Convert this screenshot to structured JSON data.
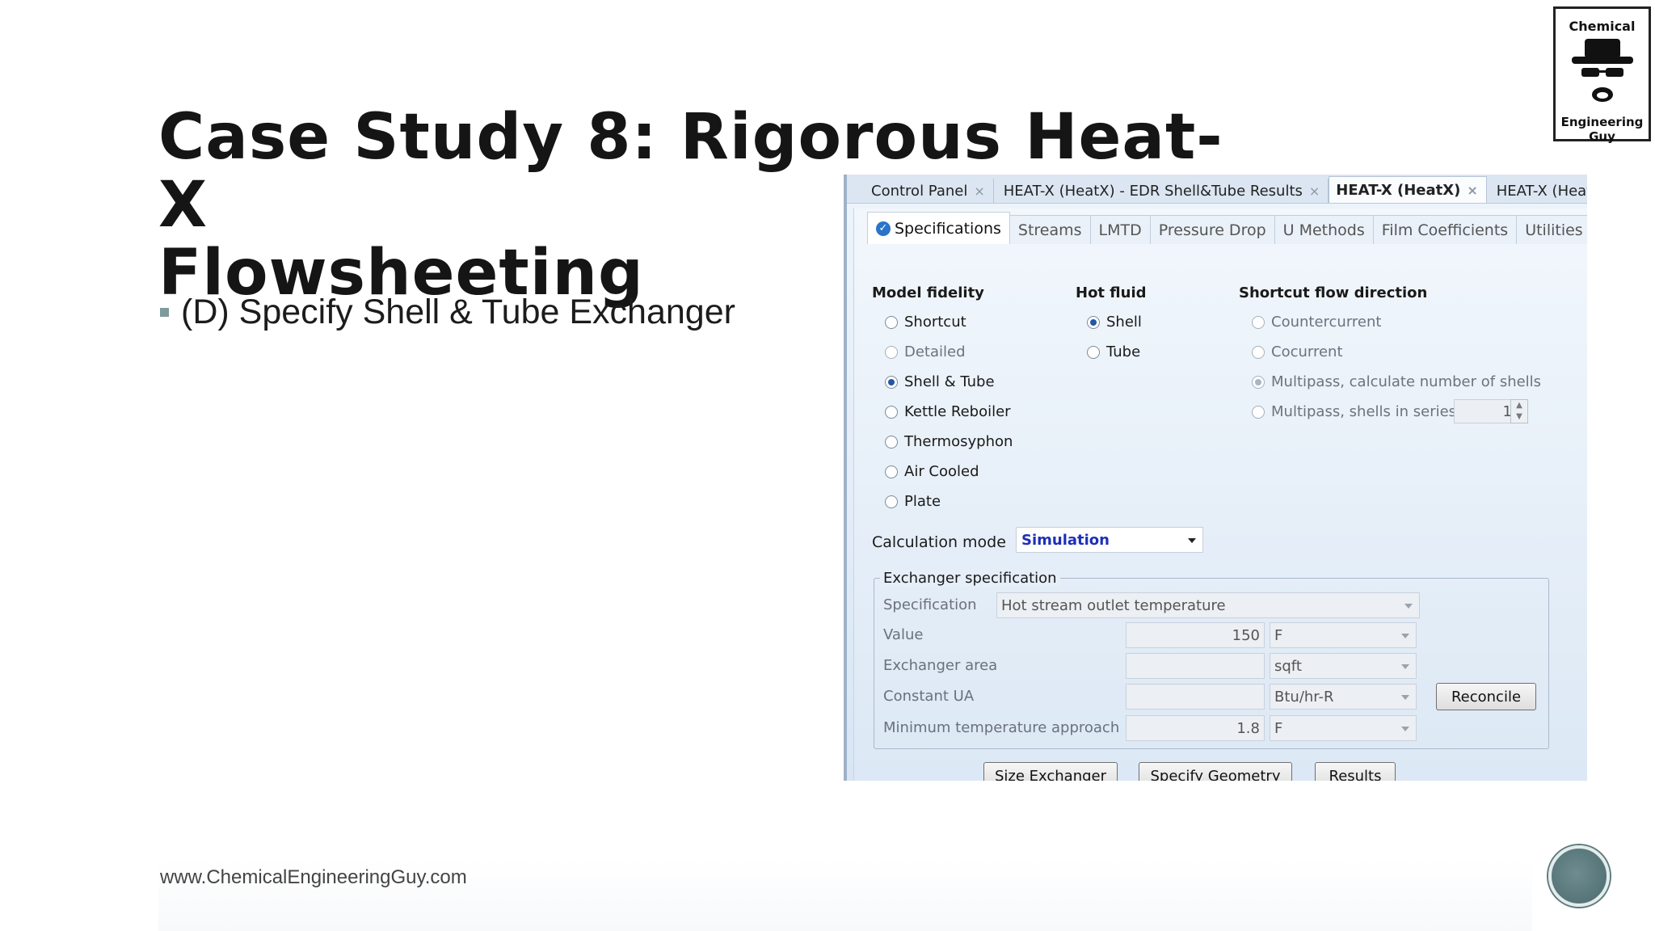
{
  "slide": {
    "title_line1": "Case Study 8: Rigorous Heat-X",
    "title_line2": "Flowsheeting",
    "bullet": "(D) Specify Shell & Tube Exchanger",
    "footer_url": "www.ChemicalEngineeringGuy.com",
    "logo": {
      "top": "Chemical",
      "bottom": "Engineering Guy"
    }
  },
  "window": {
    "doc_tabs": [
      {
        "label": "Control Panel",
        "close": "×"
      },
      {
        "label": "HEAT-X (HeatX) - EDR Shell&Tube Results",
        "close": "×"
      },
      {
        "label": "HEAT-X (HeatX)",
        "close": "×"
      },
      {
        "label": "HEAT-X (HeatX)",
        "close": ""
      }
    ],
    "sub_tabs": [
      "Specifications",
      "Streams",
      "LMTD",
      "Pressure Drop",
      "U Methods",
      "Film Coefficients",
      "Utilities"
    ],
    "model_fidelity": {
      "heading": "Model fidelity",
      "options": [
        "Shortcut",
        "Detailed",
        "Shell & Tube",
        "Kettle Reboiler",
        "Thermosyphon",
        "Air Cooled",
        "Plate"
      ],
      "selected": "Shell & Tube"
    },
    "hot_fluid": {
      "heading": "Hot fluid",
      "options": [
        "Shell",
        "Tube"
      ],
      "selected": "Shell"
    },
    "flow_direction": {
      "heading": "Shortcut flow direction",
      "options": [
        "Countercurrent",
        "Cocurrent",
        "Multipass, calculate number of shells",
        "Multipass, shells in series"
      ],
      "selected": "Multipass, calculate number of shells",
      "shells_in_series": "1"
    },
    "calculation_mode": {
      "label": "Calculation mode",
      "value": "Simulation"
    },
    "exchanger_spec": {
      "legend": "Exchanger specification",
      "specification_label": "Specification",
      "specification_value": "Hot stream outlet temperature",
      "value_label": "Value",
      "value": "150",
      "value_unit": "F",
      "area_label": "Exchanger area",
      "area_value": "",
      "area_unit": "sqft",
      "ua_label": "Constant UA",
      "ua_value": "",
      "ua_unit": "Btu/hr-R",
      "min_temp_label": "Minimum temperature approach",
      "min_temp_value": "1.8",
      "min_temp_unit": "F",
      "reconcile": "Reconcile"
    },
    "buttons": {
      "size": "Size Exchanger",
      "geometry": "Specify Geometry",
      "results": "Results"
    }
  }
}
